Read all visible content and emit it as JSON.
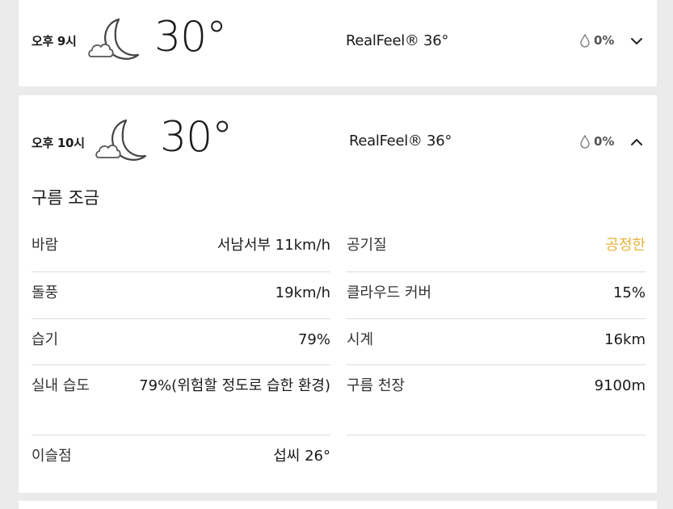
{
  "hours": [
    {
      "time": "오후 9시",
      "temp": "30°",
      "realfeel": "RealFeel® 36°",
      "precip": "0%",
      "expanded": false
    },
    {
      "time": "오후 10시",
      "temp": "30°",
      "realfeel": "RealFeel® 36°",
      "precip": "0%",
      "expanded": true,
      "phrase": "구름 조금",
      "details_left": [
        {
          "label": "바람",
          "value": "서남서부 11km/h"
        },
        {
          "label": "돌풍",
          "value": "19km/h"
        },
        {
          "label": "습기",
          "value": "79%"
        },
        {
          "label": "실내 습도",
          "value": "79%(위험할 정도로 습한 환경)"
        },
        {
          "label": "이슬점",
          "value": "섭씨 26°"
        }
      ],
      "details_right": [
        {
          "label": "공기질",
          "value": "공정한"
        },
        {
          "label": "클라우드 커버",
          "value": "15%"
        },
        {
          "label": "시계",
          "value": "16km"
        },
        {
          "label": "구름 천장",
          "value": "9100m"
        }
      ]
    }
  ],
  "icons": {
    "weather": "moon-cloud-icon",
    "precip": "raindrop-icon",
    "collapsed": "chevron-down-icon",
    "expanded": "chevron-up-icon"
  },
  "colors": {
    "accent_air_quality": "#e8b23a",
    "card_bg": "#ffffff",
    "page_bg": "#ebebeb"
  }
}
